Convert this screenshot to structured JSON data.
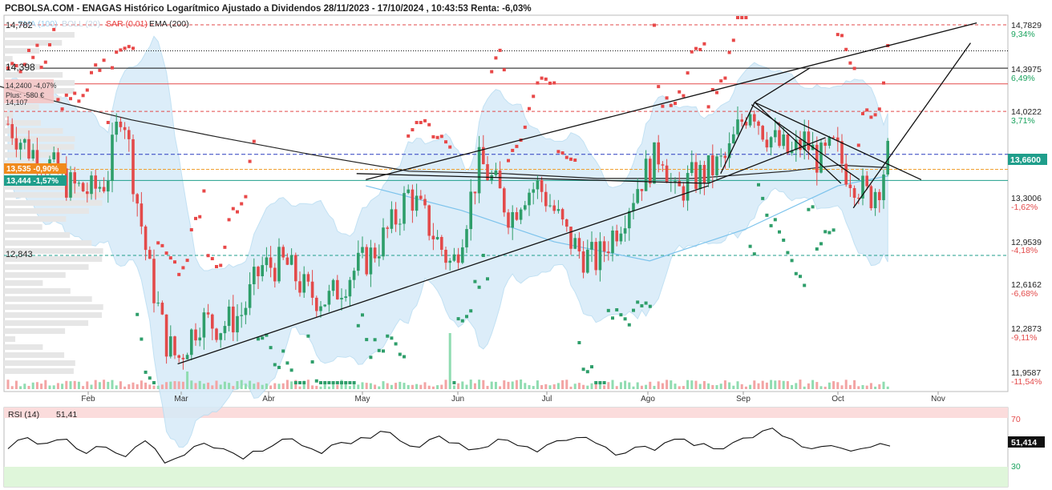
{
  "header": {
    "title": "PCBOLSA.COM - ENAGAS Histórico Logarítmico Ajustado a Dividendos 28/11/2023 - 17/10/2024 , 10:43:53 Renta: -6,03%",
    "indicators": [
      {
        "label": "SMA (100)",
        "color": "#9fd0ee"
      },
      {
        "label": "BOLL (20)",
        "color": "#c8d8e6"
      },
      {
        "label": "SAR (0.01)",
        "color": "#e83b3b"
      },
      {
        "label": "EMA (200)",
        "color": "#222222"
      }
    ]
  },
  "price_panel": {
    "left_labels": {
      "high": "14,782",
      "level_14398": "14,398",
      "low": "12,843"
    },
    "position_box": {
      "line1": "14,2400  -4,07%",
      "line2": "Plus: -580 €",
      "line3": "14,107"
    },
    "badges": [
      {
        "text": "13,535  -0,90%",
        "color": "#f08a1c"
      },
      {
        "text": "13,444  -1,57%",
        "color": "#1f9e8b"
      }
    ],
    "last_price": "13,6600",
    "y_axis": [
      {
        "price": "14,7829",
        "pct": "9,34%",
        "pct_color": "#1aa35e"
      },
      {
        "price": "14,3975",
        "pct": "6,49%",
        "pct_color": "#1aa35e"
      },
      {
        "price": "14,0222",
        "pct": "3,71%",
        "pct_color": "#1aa35e"
      },
      {
        "price": "13,6600",
        "pct": "",
        "pct_color": "#1aa35e"
      },
      {
        "price": "13,3006",
        "pct": "-1,62%",
        "pct_color": "#e34a4a"
      },
      {
        "price": "12,9539",
        "pct": "-4,18%",
        "pct_color": "#e34a4a"
      },
      {
        "price": "12,6162",
        "pct": "-6,68%",
        "pct_color": "#e34a4a"
      },
      {
        "price": "12,2873",
        "pct": "-9,11%",
        "pct_color": "#e34a4a"
      },
      {
        "price": "11,9587",
        "pct": "-11,54%",
        "pct_color": "#e34a4a"
      }
    ],
    "months": [
      "Feb",
      "Mar",
      "Abr",
      "May",
      "Jun",
      "Jul",
      "Ago",
      "Sep",
      "Oct",
      "Nov"
    ]
  },
  "rsi_panel": {
    "label": "RSI (14)",
    "value": "51,41",
    "badge": "51,414",
    "levels": [
      "70",
      "30"
    ]
  },
  "chart_data": {
    "type": "candlestick",
    "title": "ENAGAS Histórico Logarítmico Ajustado a Dividendos 28/11/2023 - 17/10/2024",
    "ylim": [
      11.96,
      14.83
    ],
    "y_scale": "log",
    "x_range": [
      "2023-11-28",
      "2024-11-25"
    ],
    "price_path": [
      [
        "2023-11-28",
        14.55
      ],
      [
        "2023-12-05",
        14.78
      ],
      [
        "2023-12-12",
        14.3
      ],
      [
        "2023-12-19",
        14.15
      ],
      [
        "2023-12-28",
        14.05
      ],
      [
        "2024-01-05",
        13.95
      ],
      [
        "2024-01-12",
        13.72
      ],
      [
        "2024-01-19",
        13.58
      ],
      [
        "2024-01-26",
        13.4
      ],
      [
        "2024-02-02",
        13.35
      ],
      [
        "2024-02-07",
        13.45
      ],
      [
        "2024-02-12",
        14.1
      ],
      [
        "2024-02-16",
        13.4
      ],
      [
        "2024-02-21",
        12.7
      ],
      [
        "2024-02-26",
        12.2
      ],
      [
        "2024-03-01",
        12.05
      ],
      [
        "2024-03-08",
        12.35
      ],
      [
        "2024-03-15",
        12.3
      ],
      [
        "2024-03-22",
        12.4
      ],
      [
        "2024-03-28",
        12.75
      ],
      [
        "2024-04-05",
        12.78
      ],
      [
        "2024-04-12",
        12.55
      ],
      [
        "2024-04-19",
        12.5
      ],
      [
        "2024-04-26",
        12.7
      ],
      [
        "2024-05-03",
        12.85
      ],
      [
        "2024-05-10",
        13.1
      ],
      [
        "2024-05-15",
        13.35
      ],
      [
        "2024-05-22",
        13.05
      ],
      [
        "2024-05-29",
        12.75
      ],
      [
        "2024-06-03",
        13.2
      ],
      [
        "2024-06-07",
        13.6
      ],
      [
        "2024-06-12",
        13.4
      ],
      [
        "2024-06-17",
        13.15
      ],
      [
        "2024-06-21",
        13.35
      ],
      [
        "2024-06-26",
        13.4
      ],
      [
        "2024-07-01",
        13.2
      ],
      [
        "2024-07-05",
        13.0
      ],
      [
        "2024-07-10",
        12.85
      ],
      [
        "2024-07-15",
        12.8
      ],
      [
        "2024-07-22",
        13.1
      ],
      [
        "2024-07-29",
        13.45
      ],
      [
        "2024-08-05",
        13.7
      ],
      [
        "2024-08-09",
        13.3
      ],
      [
        "2024-08-14",
        13.45
      ],
      [
        "2024-08-19",
        13.5
      ],
      [
        "2024-08-26",
        13.62
      ],
      [
        "2024-08-30",
        13.9
      ],
      [
        "2024-09-03",
        14.1
      ],
      [
        "2024-09-06",
        13.9
      ],
      [
        "2024-09-11",
        13.75
      ],
      [
        "2024-09-16",
        13.65
      ],
      [
        "2024-09-20",
        13.78
      ],
      [
        "2024-09-25",
        13.6
      ],
      [
        "2024-09-30",
        13.72
      ],
      [
        "2024-10-03",
        13.55
      ],
      [
        "2024-10-08",
        13.4
      ],
      [
        "2024-10-11",
        13.3
      ],
      [
        "2024-10-15",
        13.45
      ],
      [
        "2024-10-17",
        13.66
      ]
    ],
    "rsi_path": [
      48,
      62,
      55,
      60,
      42,
      50,
      38,
      58,
      30,
      40,
      55,
      48,
      35,
      45,
      60,
      52,
      42,
      56,
      62,
      70,
      58,
      50,
      64,
      55,
      48,
      60,
      52,
      44,
      58,
      62,
      55,
      40,
      50,
      46,
      60,
      52,
      48,
      56,
      62,
      74,
      60,
      48,
      52,
      45,
      50,
      51.41
    ],
    "ema200_path": [
      [
        "2023-12-13",
        14.4
      ],
      [
        "2024-01-15",
        14.15
      ],
      [
        "2024-02-15",
        13.95
      ],
      [
        "2024-03-15",
        13.8
      ],
      [
        "2024-04-15",
        13.65
      ],
      [
        "2024-05-15",
        13.52
      ],
      [
        "2024-06-15",
        13.5
      ],
      [
        "2024-07-15",
        13.46
      ],
      [
        "2024-08-15",
        13.46
      ],
      [
        "2024-09-15",
        13.52
      ],
      [
        "2024-10-01",
        13.57
      ],
      [
        "2024-10-17",
        13.55
      ]
    ]
  }
}
